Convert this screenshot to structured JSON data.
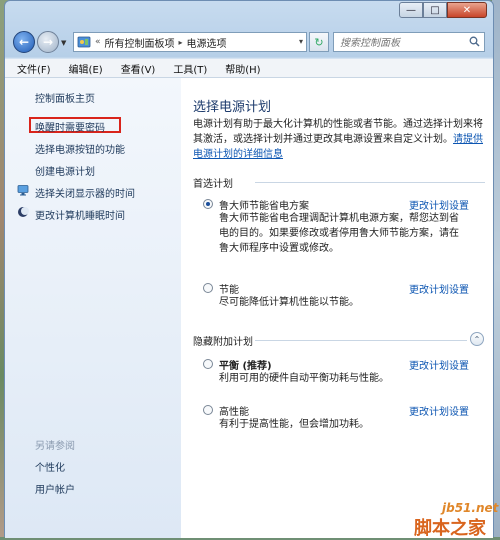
{
  "window": {
    "min_label": "—",
    "max_label": "□",
    "close_label": "✕"
  },
  "address": {
    "separator": "«",
    "crumb1": "所有控制面板项",
    "arrow": "▸",
    "crumb2": "电源选项",
    "dropdown": "▾"
  },
  "search": {
    "placeholder": "搜索控制面板"
  },
  "menu": [
    "文件(F)",
    "编辑(E)",
    "查看(V)",
    "工具(T)",
    "帮助(H)"
  ],
  "sidebar": {
    "home": "控制面板主页",
    "items": [
      "唤醒时需要密码",
      "选择电源按钮的功能",
      "创建电源计划",
      "选择关闭显示器的时间",
      "更改计算机睡眠时间"
    ],
    "see_also_title": "另请参阅",
    "see_also": [
      "个性化",
      "用户帐户"
    ]
  },
  "content": {
    "title": "选择电源计划",
    "intro": "电源计划有助于最大化计算机的性能或者节能。通过选择计划来将其激活，或选择计划并通过更改其电源设置来自定义计划。",
    "intro_link": "请提供电源计划的详细信息",
    "preferred_group": "首选计划",
    "hidden_group": "隐藏附加计划",
    "collapse_icon": "⌃",
    "plans": [
      {
        "name": "鲁大师节能省电方案",
        "link": "更改计划设置",
        "desc": "鲁大师节能省电合理调配计算机电源方案，帮您达到省电的目的。如果要修改或者停用鲁大师节能方案，请在鲁大师程序中设置或修改。",
        "selected": true
      },
      {
        "name": "节能",
        "link": "更改计划设置",
        "desc": "尽可能降低计算机性能以节能。",
        "selected": false
      },
      {
        "name": "平衡 (推荐)",
        "link": "更改计划设置",
        "desc": "利用可用的硬件自动平衡功耗与性能。",
        "selected": false
      },
      {
        "name": "高性能",
        "link": "更改计划设置",
        "desc": "有利于提高性能，但会增加功耗。",
        "selected": false
      }
    ]
  },
  "watermark": {
    "site": "jb51.net",
    "name": "脚本之家"
  },
  "colors": {
    "highlight_box": "#d9241b",
    "link": "#0d56b2"
  }
}
